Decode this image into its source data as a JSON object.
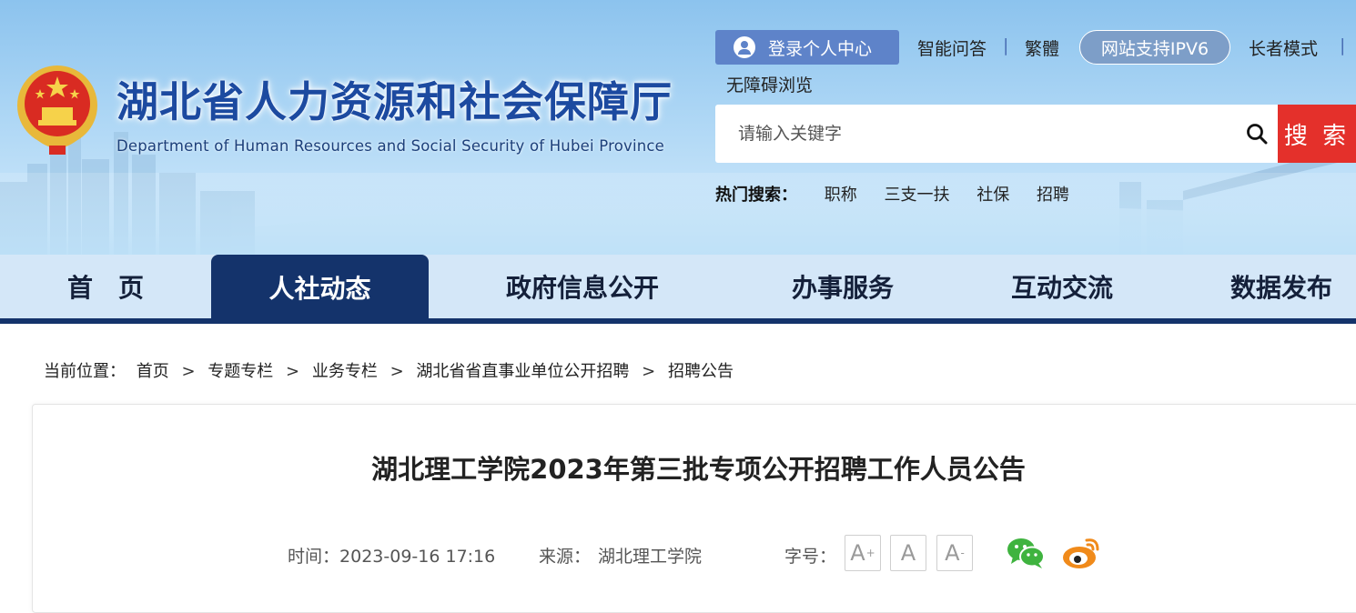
{
  "header": {
    "title": "湖北省人力资源和社会保障厅",
    "subtitle": "Department of Human Resources and Social Security of Hubei Province",
    "emblem_icon": "national-emblem-icon"
  },
  "top_links": {
    "login": "登录个人中心",
    "smart_qa": "智能问答",
    "separator": "|",
    "traditional": "繁體",
    "ipv6": "网站支持IPV6",
    "elder_mode": "长者模式",
    "accessibility": "无障碍浏览"
  },
  "search": {
    "placeholder": "请输入关键字",
    "button": "搜 索",
    "hot_label": "热门搜索：",
    "hot_items": [
      "职称",
      "三支一扶",
      "社保",
      "招聘"
    ]
  },
  "nav": {
    "items": [
      "首　页",
      "人社动态",
      "政府信息公开",
      "办事服务",
      "互动交流",
      "数据发布"
    ],
    "active_index": 1
  },
  "breadcrumb": {
    "label": "当前位置：",
    "items": [
      "首页",
      "专题专栏",
      "业务专栏",
      "湖北省省直事业单位公开招聘",
      "招聘公告"
    ],
    "separator": ">"
  },
  "article": {
    "title": "湖北理工学院2023年第三批专项公开招聘工作人员公告",
    "time_label": "时间：",
    "time": "2023-09-16 17:16",
    "source_label": "来源：",
    "source": "湖北理工学院",
    "font_size_label": "字号：",
    "font_buttons": [
      "A",
      "A",
      "A"
    ],
    "font_button_marks": [
      "+",
      "",
      "-"
    ]
  },
  "colors": {
    "nav_active": "#14336b",
    "search_button": "#e4302b",
    "title_blue": "#1c4aa0",
    "wechat": "#3fb33f",
    "weibo": "#f08a1a"
  }
}
